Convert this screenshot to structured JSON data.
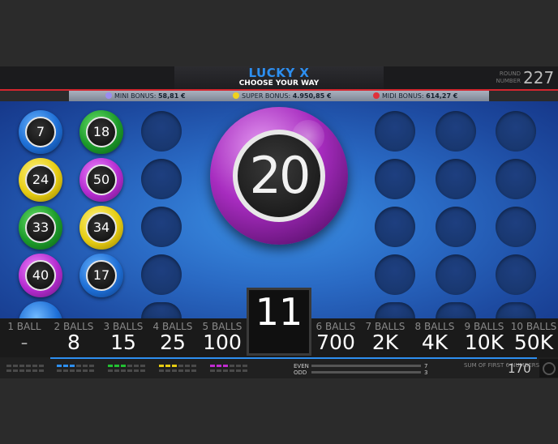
{
  "header": {
    "title": "LUCKY X",
    "subtitle": "CHOOSE YOUR WAY",
    "round_label": "ROUND NUMBER",
    "round_number": "227"
  },
  "bonuses": [
    {
      "label": "MINI BONUS:",
      "value": "58,81 €",
      "color": "#9b8cf0"
    },
    {
      "label": "SUPER BONUS:",
      "value": "4.950,85 €",
      "color": "#f0d21e"
    },
    {
      "label": "MIDI BONUS:",
      "value": "614,27 €",
      "color": "#e0303a"
    }
  ],
  "drawn_balls": [
    {
      "number": "7",
      "color": "blue"
    },
    {
      "number": "18",
      "color": "green"
    },
    {
      "number": "24",
      "color": "yellow"
    },
    {
      "number": "50",
      "color": "purple"
    },
    {
      "number": "33",
      "color": "green"
    },
    {
      "number": "34",
      "color": "yellow"
    },
    {
      "number": "40",
      "color": "purple"
    },
    {
      "number": "17",
      "color": "blue"
    }
  ],
  "current_ball": {
    "number": "20",
    "color": "purple"
  },
  "balls_drawn_count": "11",
  "paytable": [
    {
      "label": "1 BALL",
      "value": "-"
    },
    {
      "label": "2 BALLS",
      "value": "8"
    },
    {
      "label": "3 BALLS",
      "value": "15"
    },
    {
      "label": "4 BALLS",
      "value": "25"
    },
    {
      "label": "5 BALLS",
      "value": "100"
    },
    {
      "label": "6 BALLS",
      "value": "700"
    },
    {
      "label": "7 BALLS",
      "value": "2K"
    },
    {
      "label": "8 BALLS",
      "value": "4K"
    },
    {
      "label": "9 BALLS",
      "value": "10K"
    },
    {
      "label": "10 BALLS",
      "value": "50K"
    }
  ],
  "stats": {
    "even_label": "EVEN",
    "even_value": "7",
    "odd_label": "ODD",
    "odd_value": "3",
    "sum_label": "SUM OF FIRST 6 NUMBERS",
    "sum_value": "170"
  },
  "footer_colors": [
    "#555555",
    "#2d8ff0",
    "#22c032",
    "#e6cc12",
    "#c02bd0"
  ]
}
